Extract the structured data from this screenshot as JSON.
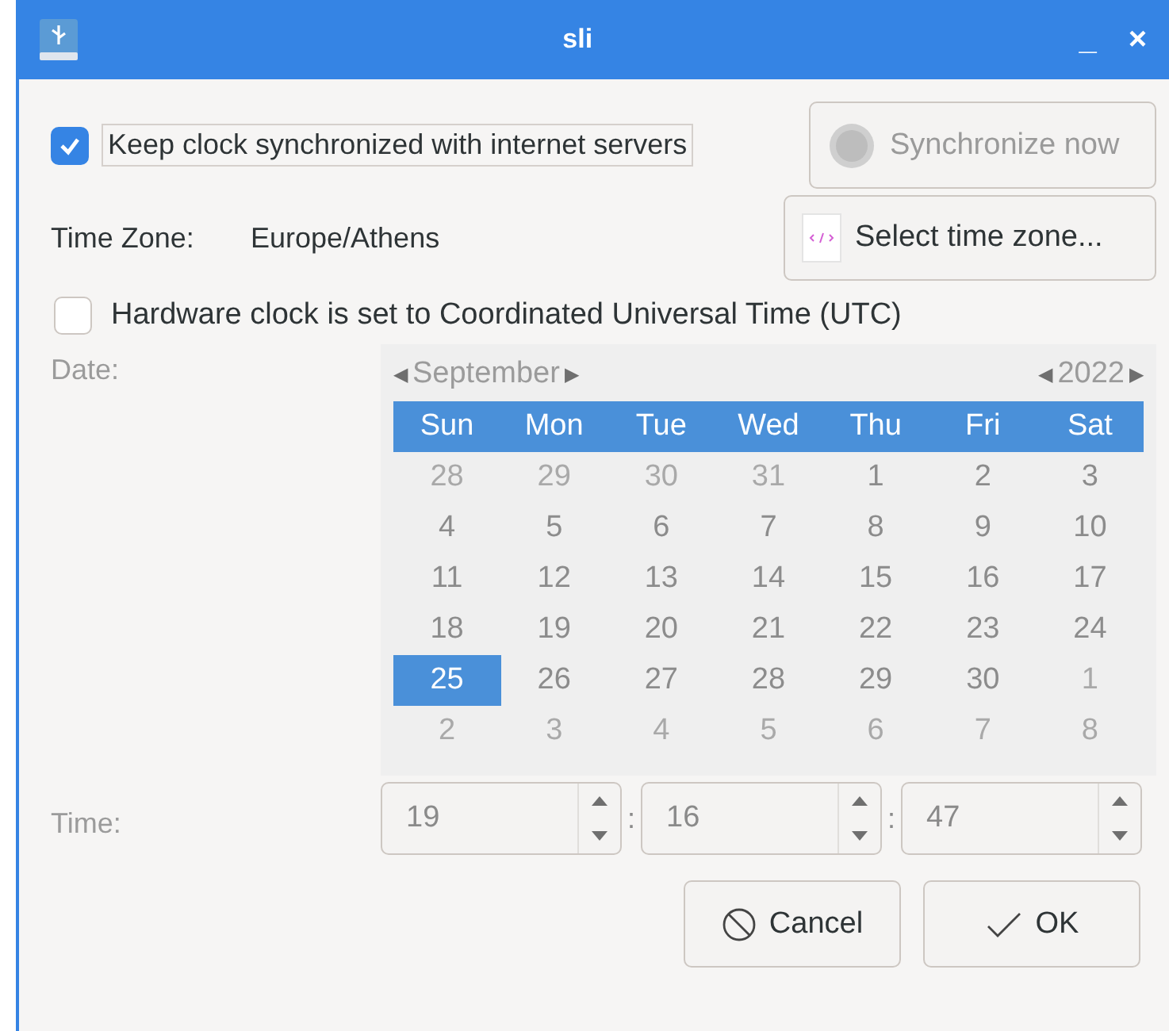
{
  "window": {
    "title": "sli",
    "buttons": [
      "_",
      "×"
    ]
  },
  "sync": {
    "label": "Keep clock synchronized with internet servers",
    "checked": true,
    "button": "Synchronize now",
    "button_disabled": true
  },
  "timezone": {
    "label": "Time Zone:",
    "value": "Europe/Athens",
    "button": "Select time zone..."
  },
  "utc": {
    "label": "Hardware clock is set to Coordinated Universal Time (UTC)",
    "checked": false
  },
  "date": {
    "label": "Date:",
    "month": "September",
    "year": "2022",
    "prev": "◀",
    "next": "▶",
    "weekdays": [
      "Sun",
      "Mon",
      "Tue",
      "Wed",
      "Thu",
      "Fri",
      "Sat"
    ],
    "weeks": [
      [
        {
          "day": "28",
          "in_month": false,
          "selected": false
        },
        {
          "day": "29",
          "in_month": false,
          "selected": false
        },
        {
          "day": "30",
          "in_month": false,
          "selected": false
        },
        {
          "day": "31",
          "in_month": false,
          "selected": false
        },
        {
          "day": "1",
          "in_month": true,
          "selected": false
        },
        {
          "day": "2",
          "in_month": true,
          "selected": false
        },
        {
          "day": "3",
          "in_month": true,
          "selected": false
        }
      ],
      [
        {
          "day": "4",
          "in_month": true,
          "selected": false
        },
        {
          "day": "5",
          "in_month": true,
          "selected": false
        },
        {
          "day": "6",
          "in_month": true,
          "selected": false
        },
        {
          "day": "7",
          "in_month": true,
          "selected": false
        },
        {
          "day": "8",
          "in_month": true,
          "selected": false
        },
        {
          "day": "9",
          "in_month": true,
          "selected": false
        },
        {
          "day": "10",
          "in_month": true,
          "selected": false
        }
      ],
      [
        {
          "day": "11",
          "in_month": true,
          "selected": false
        },
        {
          "day": "12",
          "in_month": true,
          "selected": false
        },
        {
          "day": "13",
          "in_month": true,
          "selected": false
        },
        {
          "day": "14",
          "in_month": true,
          "selected": false
        },
        {
          "day": "15",
          "in_month": true,
          "selected": false
        },
        {
          "day": "16",
          "in_month": true,
          "selected": false
        },
        {
          "day": "17",
          "in_month": true,
          "selected": false
        }
      ],
      [
        {
          "day": "18",
          "in_month": true,
          "selected": false
        },
        {
          "day": "19",
          "in_month": true,
          "selected": false
        },
        {
          "day": "20",
          "in_month": true,
          "selected": false
        },
        {
          "day": "21",
          "in_month": true,
          "selected": false
        },
        {
          "day": "22",
          "in_month": true,
          "selected": false
        },
        {
          "day": "23",
          "in_month": true,
          "selected": false
        },
        {
          "day": "24",
          "in_month": true,
          "selected": false
        }
      ],
      [
        {
          "day": "25",
          "in_month": true,
          "selected": true
        },
        {
          "day": "26",
          "in_month": true,
          "selected": false
        },
        {
          "day": "27",
          "in_month": true,
          "selected": false
        },
        {
          "day": "28",
          "in_month": true,
          "selected": false
        },
        {
          "day": "29",
          "in_month": true,
          "selected": false
        },
        {
          "day": "30",
          "in_month": true,
          "selected": false
        },
        {
          "day": "1",
          "in_month": false,
          "selected": false
        }
      ],
      [
        {
          "day": "2",
          "in_month": false,
          "selected": false
        },
        {
          "day": "3",
          "in_month": false,
          "selected": false
        },
        {
          "day": "4",
          "in_month": false,
          "selected": false
        },
        {
          "day": "5",
          "in_month": false,
          "selected": false
        },
        {
          "day": "6",
          "in_month": false,
          "selected": false
        },
        {
          "day": "7",
          "in_month": false,
          "selected": false
        },
        {
          "day": "8",
          "in_month": false,
          "selected": false
        }
      ]
    ]
  },
  "time": {
    "label": "Time:",
    "separator": ":",
    "fields": [
      "19",
      "16",
      "47"
    ]
  },
  "buttons": [
    {
      "kind": "cancel",
      "label": "Cancel"
    },
    {
      "kind": "ok",
      "label": "OK"
    }
  ]
}
